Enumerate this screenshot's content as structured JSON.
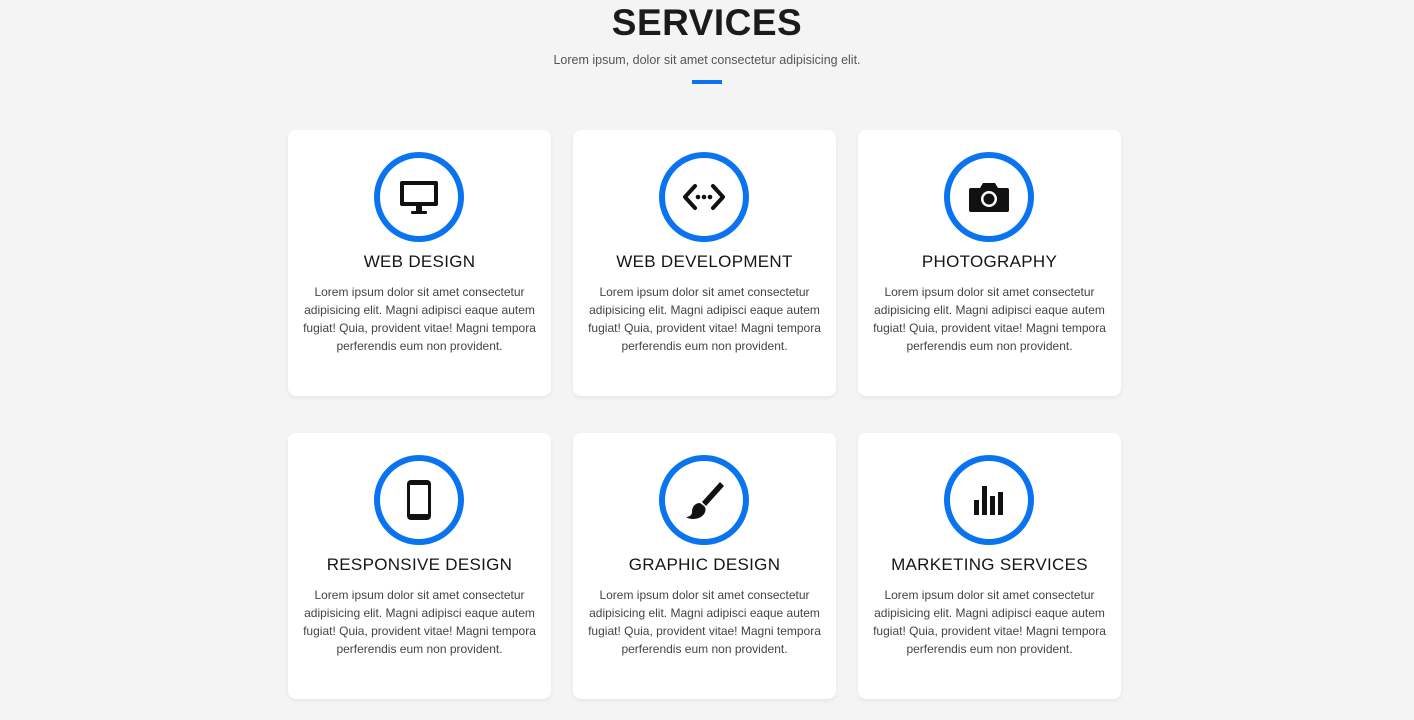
{
  "section": {
    "title": "SERVICES",
    "subtitle": "Lorem ipsum, dolor sit amet consectetur adipisicing elit."
  },
  "colors": {
    "accent": "#0a74f0",
    "background": "#f4f4f4",
    "card": "#ffffff",
    "icon": "#111111"
  },
  "services": [
    {
      "icon": "monitor-icon",
      "title": "WEB DESIGN",
      "text": "Lorem ipsum dolor sit amet consectetur adipisicing elit. Magni adipisci eaque autem fugiat! Quia, provident vitae! Magni tempora perferendis eum non provident."
    },
    {
      "icon": "code-icon",
      "title": "WEB DEVELOPMENT",
      "text": "Lorem ipsum dolor sit amet consectetur adipisicing elit. Magni adipisci eaque autem fugiat! Quia, provident vitae! Magni tempora perferendis eum non provident."
    },
    {
      "icon": "camera-icon",
      "title": "PHOTOGRAPHY",
      "text": "Lorem ipsum dolor sit amet consectetur adipisicing elit. Magni adipisci eaque autem fugiat! Quia, provident vitae! Magni tempora perferendis eum non provident."
    },
    {
      "icon": "mobile-icon",
      "title": "RESPONSIVE DESIGN",
      "text": "Lorem ipsum dolor sit amet consectetur adipisicing elit. Magni adipisci eaque autem fugiat! Quia, provident vitae! Magni tempora perferendis eum non provident."
    },
    {
      "icon": "paintbrush-icon",
      "title": "GRAPHIC DESIGN",
      "text": "Lorem ipsum dolor sit amet consectetur adipisicing elit. Magni adipisci eaque autem fugiat! Quia, provident vitae! Magni tempora perferendis eum non provident."
    },
    {
      "icon": "bar-chart-icon",
      "title": "MARKETING SERVICES",
      "text": "Lorem ipsum dolor sit amet consectetur adipisicing elit. Magni adipisci eaque autem fugiat! Quia, provident vitae! Magni tempora perferendis eum non provident."
    }
  ]
}
